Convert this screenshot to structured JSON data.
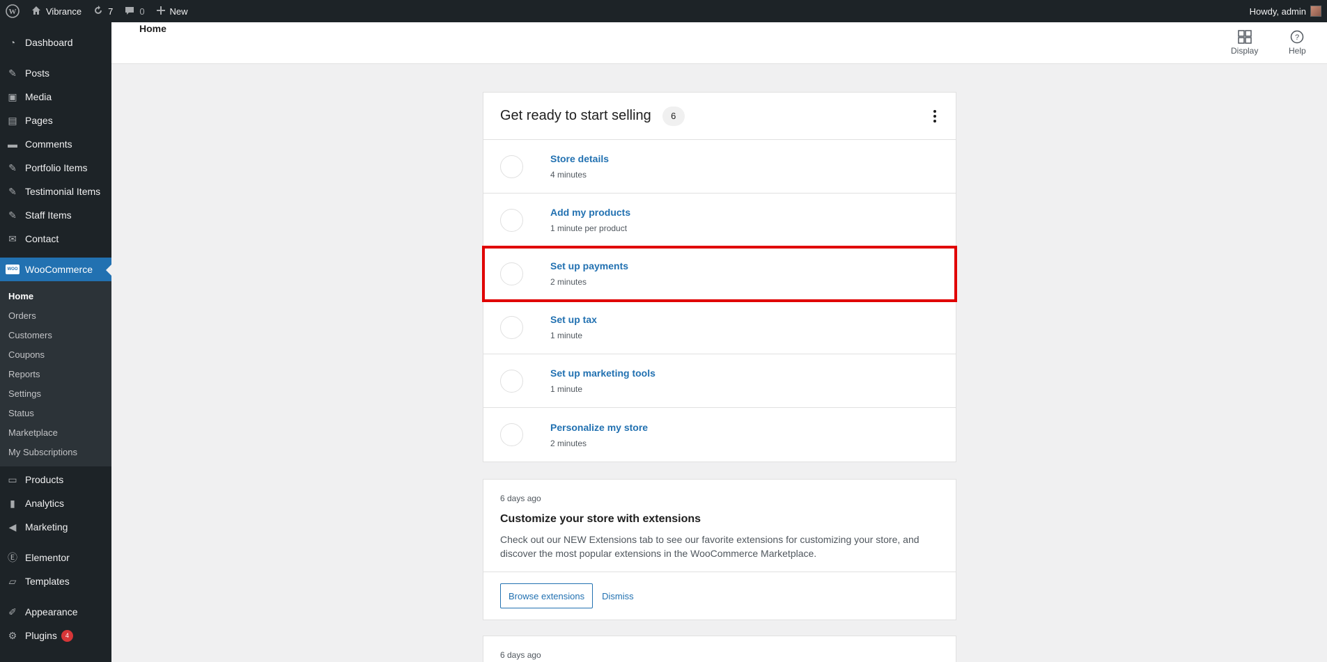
{
  "adminbar": {
    "site_name": "Vibrance",
    "updates_count": "7",
    "comments_count": "0",
    "new_label": "New",
    "howdy": "Howdy, admin"
  },
  "sidebar": {
    "items_top": [
      {
        "label": "Dashboard",
        "icon": "dashboard-icon"
      },
      {
        "label": "Posts",
        "icon": "pin-icon"
      },
      {
        "label": "Media",
        "icon": "media-icon"
      },
      {
        "label": "Pages",
        "icon": "pages-icon"
      },
      {
        "label": "Comments",
        "icon": "comment-icon"
      },
      {
        "label": "Portfolio Items",
        "icon": "pin-icon"
      },
      {
        "label": "Testimonial Items",
        "icon": "pin-icon"
      },
      {
        "label": "Staff Items",
        "icon": "pin-icon"
      },
      {
        "label": "Contact",
        "icon": "mail-icon"
      }
    ],
    "woocommerce": {
      "label": "WooCommerce",
      "logo_text": "WOO",
      "submenu": [
        "Home",
        "Orders",
        "Customers",
        "Coupons",
        "Reports",
        "Settings",
        "Status",
        "Marketplace",
        "My Subscriptions"
      ]
    },
    "items_bottom": [
      {
        "label": "Products",
        "icon": "products-icon"
      },
      {
        "label": "Analytics",
        "icon": "analytics-icon"
      },
      {
        "label": "Marketing",
        "icon": "megaphone-icon"
      },
      {
        "label": "Elementor",
        "icon": "elementor-icon"
      },
      {
        "label": "Templates",
        "icon": "folder-icon"
      },
      {
        "label": "Appearance",
        "icon": "brush-icon"
      },
      {
        "label": "Plugins",
        "icon": "plugin-icon",
        "badge": "4"
      }
    ]
  },
  "header": {
    "title": "Home",
    "display_label": "Display",
    "help_label": "Help"
  },
  "tasklist": {
    "title": "Get ready to start selling",
    "count": "6",
    "tasks": [
      {
        "title": "Store details",
        "time": "4 minutes"
      },
      {
        "title": "Add my products",
        "time": "1 minute per product"
      },
      {
        "title": "Set up payments",
        "time": "2 minutes"
      },
      {
        "title": "Set up tax",
        "time": "1 minute"
      },
      {
        "title": "Set up marketing tools",
        "time": "1 minute"
      },
      {
        "title": "Personalize my store",
        "time": "2 minutes"
      }
    ]
  },
  "notes": [
    {
      "date": "6 days ago",
      "title": "Customize your store with extensions",
      "text": "Check out our NEW Extensions tab to see our favorite extensions for customizing your store, and discover the most popular extensions in the WooCommerce Marketplace.",
      "primary_action": "Browse extensions",
      "dismiss": "Dismiss"
    },
    {
      "date": "6 days ago"
    }
  ],
  "colors": {
    "admin_dark": "#1d2327",
    "accent": "#2271b1",
    "highlight": "#e00000"
  }
}
